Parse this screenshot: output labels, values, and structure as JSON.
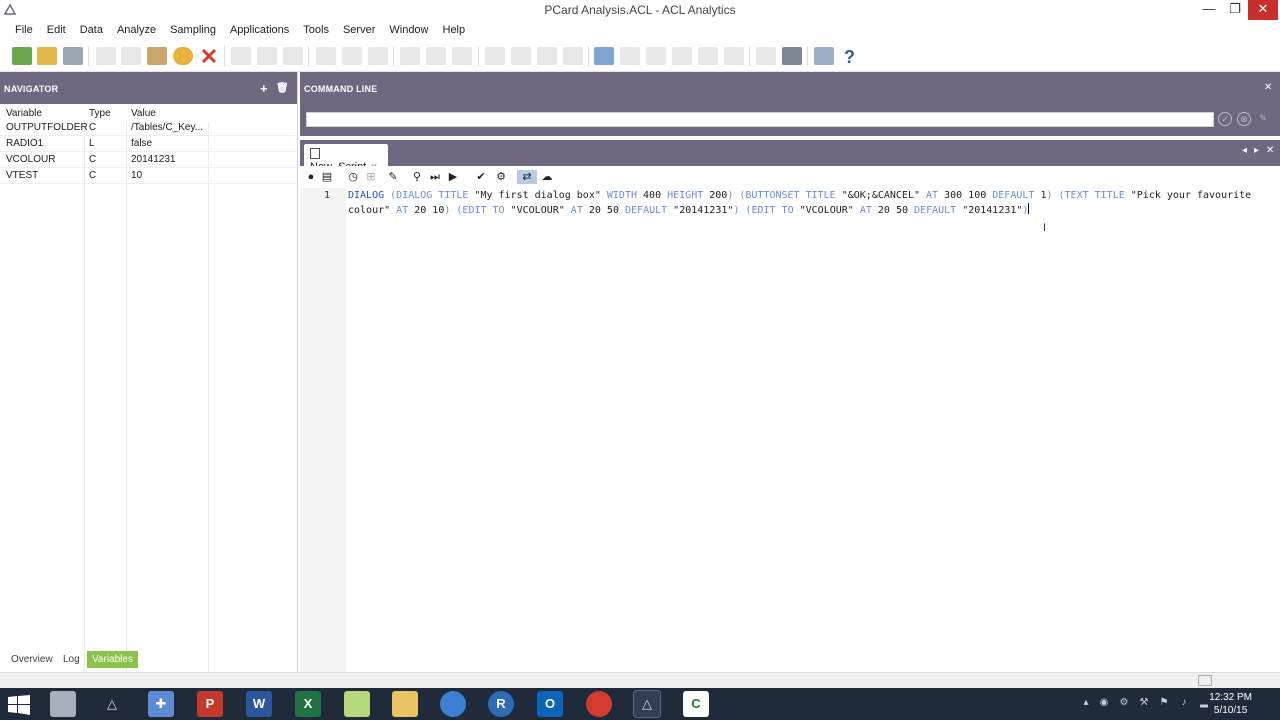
{
  "window": {
    "title": "PCard Analysis.ACL - ACL Analytics",
    "minimize": "—",
    "maximize": "❐",
    "close": "✕"
  },
  "menu": [
    "File",
    "Edit",
    "Data",
    "Analyze",
    "Sampling",
    "Applications",
    "Tools",
    "Server",
    "Window",
    "Help"
  ],
  "navigator": {
    "title": "NAVIGATOR",
    "add_icon": "+",
    "delete_icon": "🗑",
    "columns": {
      "variable": "Variable",
      "type": "Type",
      "value": "Value"
    },
    "rows": [
      {
        "variable": "OUTPUTFOLDER",
        "type": "C",
        "value": "/Tables/C_Key..."
      },
      {
        "variable": "RADIO1",
        "type": "L",
        "value": "false"
      },
      {
        "variable": "VCOLOUR",
        "type": "C",
        "value": "20141231"
      },
      {
        "variable": "VTEST",
        "type": "C",
        "value": "10"
      }
    ],
    "tabs": {
      "overview": "Overview",
      "log": "Log",
      "variables": "Variables"
    }
  },
  "command_line": {
    "title": "COMMAND LINE",
    "close": "✕",
    "value": "",
    "ok_icon": "✓",
    "cancel_icon": "⊗",
    "edit_icon": "✎"
  },
  "script": {
    "tab_label": "New_Script",
    "tab_close": "✕",
    "line_number": "1",
    "nav_prev": "◂",
    "nav_next": "▸",
    "close": "✕",
    "code": {
      "c1": "DIALOG",
      "c2": " (DIALOG TITLE ",
      "c3": "\"My first dialog box\"",
      "c4": " WIDTH ",
      "c5": "400",
      "c6": " HEIGHT ",
      "c7": "200",
      "c8": ") (BUTTONSET TITLE ",
      "c9": "\"&OK;&CANCEL\"",
      "c10": " AT ",
      "c11": "300 100",
      "c12": " DEFAULT ",
      "c13": "1",
      "c14": ") (TEXT TITLE ",
      "c15": "\"Pick your favourite colour\"",
      "c16": " AT ",
      "c17": "20 10",
      "c18": ") (EDIT TO ",
      "c19": "\"VCOLOUR\"",
      "c20": " AT ",
      "c21": "20 50",
      "c22": " DEFAULT ",
      "c23": "\"20141231\"",
      "c24": ") (EDIT TO ",
      "c25": "\"VCOLOUR\"",
      "c26": " AT ",
      "c27": "20 50",
      "c28": " DEFAULT ",
      "c29": "\"20141231\"",
      "c30": ")"
    }
  },
  "taskbar": {
    "clock_time": "12:32 PM",
    "clock_date": "5/10/15",
    "apps": [
      "windows-start",
      "tool",
      "acl",
      "grid",
      "P",
      "W",
      "X",
      "folder-green",
      "folder",
      "refresh",
      "R",
      "O",
      "chrome",
      "acl-active",
      "C"
    ]
  }
}
